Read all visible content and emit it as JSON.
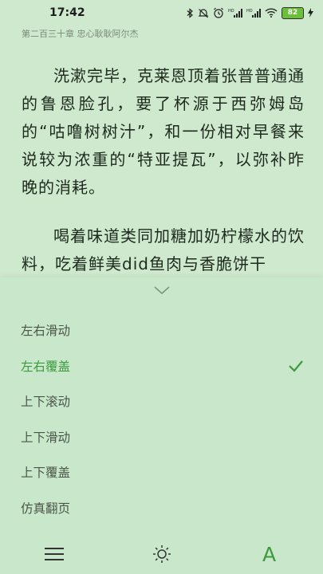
{
  "status_bar": {
    "time": "17:42",
    "battery": "82",
    "icons": [
      "bluetooth-icon",
      "mute-icon",
      "alarm-icon",
      "signal-hd-icon",
      "signal-hd-icon",
      "wifi-icon",
      "battery-icon",
      "charging-icon"
    ]
  },
  "chapter_title": "第二百三十章 忠心耿耿阿尔杰",
  "content": {
    "paragraphs": [
      "洗漱完毕，克莱恩顶着张普普通通的鲁恩脸孔，要了杯源于西弥姆岛的“咕噜树树汁”，和一份相对早餐来说较为浓重的“特亚提瓦”，以弥补昨晚的消耗。",
      "喝着味道类同加糖加奶柠檬水的饮料，吃着鲜美did鱼肉与香脆饼干"
    ]
  },
  "page_mode_menu": {
    "items": [
      {
        "label": "左右滑动",
        "selected": false
      },
      {
        "label": "左右覆盖",
        "selected": true
      },
      {
        "label": "上下滚动",
        "selected": false
      },
      {
        "label": "上下滑动",
        "selected": false
      },
      {
        "label": "上下覆盖",
        "selected": false
      },
      {
        "label": "仿真翻页",
        "selected": false
      }
    ]
  },
  "bottom_nav": {
    "menu_icon": "menu-icon",
    "brightness_icon": "brightness-icon",
    "font_label": "A"
  },
  "colors": {
    "background": "#cfe9cf",
    "sheet": "#c9e8cb",
    "accent": "#3c9a3c",
    "text": "#1d2a1d"
  }
}
